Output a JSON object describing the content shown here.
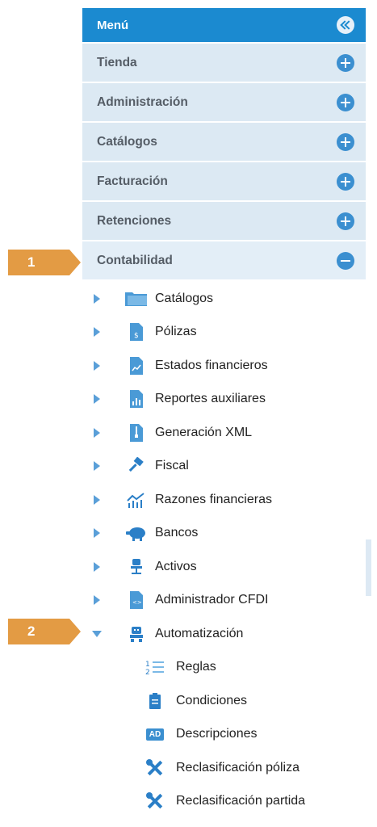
{
  "menu": {
    "title": "Menú",
    "sections": [
      {
        "label": "Tienda"
      },
      {
        "label": "Administración"
      },
      {
        "label": "Catálogos"
      },
      {
        "label": "Facturación"
      },
      {
        "label": "Retenciones"
      },
      {
        "label": "Contabilidad"
      }
    ],
    "contabilidad_items": [
      {
        "label": "Catálogos",
        "icon": "folder-icon"
      },
      {
        "label": "Pólizas",
        "icon": "document-dollar-icon"
      },
      {
        "label": "Estados financieros",
        "icon": "document-chart-icon"
      },
      {
        "label": "Reportes auxiliares",
        "icon": "bar-chart-icon"
      },
      {
        "label": "Generación XML",
        "icon": "document-zip-icon"
      },
      {
        "label": "Fiscal",
        "icon": "gavel-icon"
      },
      {
        "label": "Razones financieras",
        "icon": "trend-chart-icon"
      },
      {
        "label": "Bancos",
        "icon": "piggy-bank-icon"
      },
      {
        "label": "Activos",
        "icon": "office-chair-icon"
      },
      {
        "label": "Administrador CFDI",
        "icon": "document-code-icon"
      },
      {
        "label": "Automatización",
        "icon": "robot-icon"
      }
    ],
    "automatizacion_items": [
      {
        "label": "Reglas",
        "icon": "numbered-list-icon"
      },
      {
        "label": "Condiciones",
        "icon": "clipboard-icon"
      },
      {
        "label": "Descripciones",
        "icon": "ad-badge-icon",
        "badge": "AD"
      },
      {
        "label": "Reclasificación póliza",
        "icon": "tools-icon"
      },
      {
        "label": "Reclasificación partida",
        "icon": "tools-icon"
      }
    ]
  },
  "callouts": [
    {
      "number": "1"
    },
    {
      "number": "2"
    }
  ],
  "colors": {
    "header": "#1b8ad0",
    "section_bg": "#dce9f3",
    "callout": "#e39b44",
    "icon_blue": "#3b8fd0"
  }
}
